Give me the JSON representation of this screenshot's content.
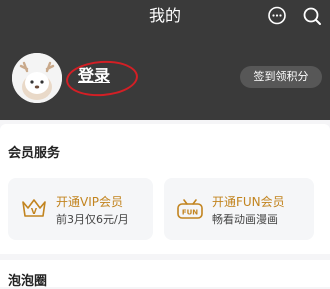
{
  "header": {
    "title": "我的",
    "message_icon": "message-bubble-icon",
    "search_icon": "search-icon"
  },
  "profile": {
    "login_label": "登录",
    "signin_button_label": "签到领积分"
  },
  "membership": {
    "section_title": "会员服务",
    "cards": [
      {
        "title": "开通VIP会员",
        "subtitle": "前3月仅6元/月",
        "icon": "vip-crown-icon"
      },
      {
        "title": "开通FUN会员",
        "subtitle": "畅看动画漫画",
        "icon": "fun-badge-icon"
      }
    ]
  },
  "bubble_circle": {
    "section_title": "泡泡圈"
  },
  "colors": {
    "header_bg": "#3a3a3a",
    "accent_gold": "#c2841f",
    "highlight_red": "#d31f25"
  }
}
